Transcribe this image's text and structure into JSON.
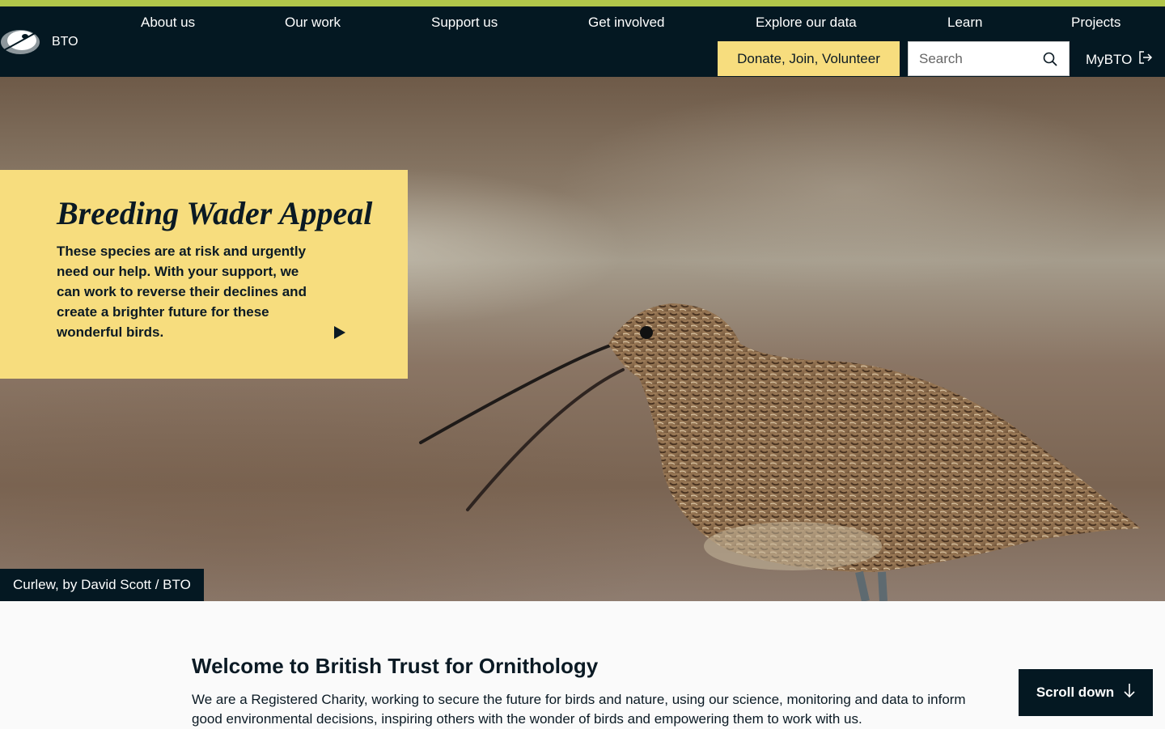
{
  "brand": {
    "name": "BTO"
  },
  "nav": {
    "items": [
      {
        "label": "About us"
      },
      {
        "label": "Our work"
      },
      {
        "label": "Support us"
      },
      {
        "label": "Get involved"
      },
      {
        "label": "Explore our data"
      },
      {
        "label": "Learn"
      },
      {
        "label": "Projects"
      }
    ],
    "donate_label": "Donate, Join, Volunteer",
    "search_placeholder": "Search",
    "mybto_label": "MyBTO"
  },
  "hero": {
    "promo_title": "Breeding Wader Appeal",
    "promo_text": "These species are at risk and urgently need our help. With your support, we can work to reverse their declines and create a brighter future for these wonderful birds.",
    "caption": "Curlew, by David Scott / BTO"
  },
  "welcome": {
    "title": "Welcome to British Trust for Ornithology",
    "text": "We are a Registered Charity, working to secure the future for birds and nature, using our science, monitoring and data to inform good environmental decisions, inspiring others with the wonder of birds and empowering them to work with us."
  },
  "scroll_label": "Scroll down",
  "colors": {
    "header": "#041822",
    "accent": "#f7dd7e",
    "stripe": "#b2c64a"
  }
}
